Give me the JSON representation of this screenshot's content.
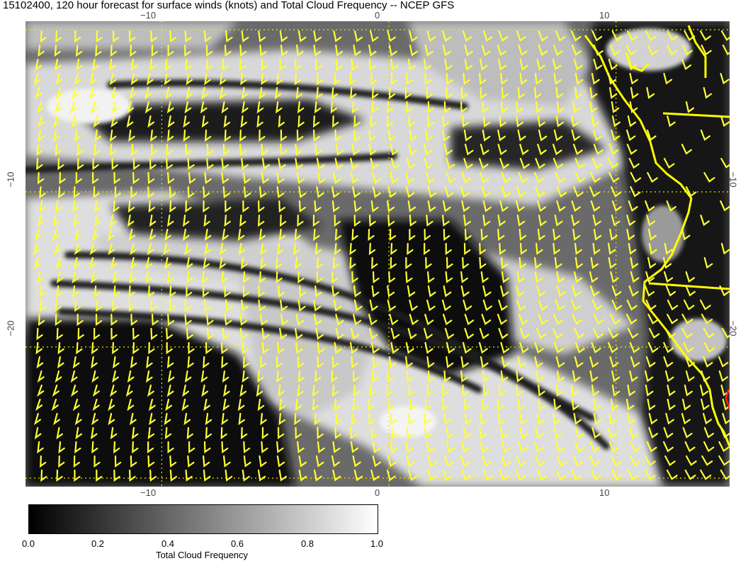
{
  "title": "15102400, 120 hour forecast for surface winds (knots) and Total Cloud Frequency -- NCEP GFS",
  "map": {
    "lon_range": [
      -16,
      15
    ],
    "lat_range": [
      -29,
      1
    ],
    "lon_ticks": [
      "−10",
      "0",
      "10"
    ],
    "lat_ticks": [
      "−10",
      "−20"
    ],
    "barb_color": "#ffff33",
    "coast_color": "#ffff00",
    "marker_color": "#ff2020",
    "marker": {
      "lon": 15.4,
      "lat": -23.4
    }
  },
  "colorbar": {
    "label": "Total Cloud Frequency",
    "ticks": [
      "0.0",
      "0.2",
      "0.4",
      "0.6",
      "0.8",
      "1.0"
    ],
    "range": [
      0,
      1
    ]
  }
}
